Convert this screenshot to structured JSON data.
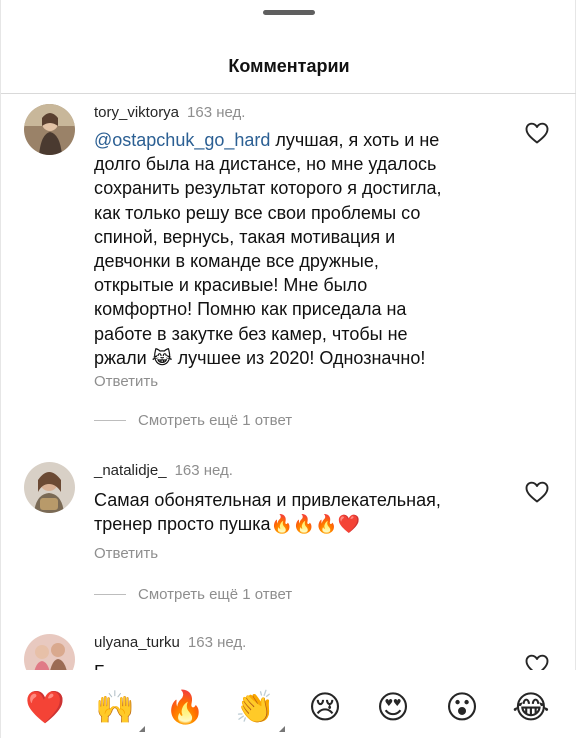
{
  "sheet": {
    "title": "Комментарии"
  },
  "comments": [
    {
      "username": "tory_viktorya",
      "time": "163 нед.",
      "mention": "@ostapchuk_go_hard",
      "lines": [
        " лучшая, я хоть и не",
        "долго была на дистансе, но мне удалось",
        "сохранить результат которого я достигла,",
        "как только решу все свои проблемы со",
        "спиной, вернусь, такая мотивация и",
        "девчонки в команде все дружные,",
        "открытые и красивые! Мне было",
        "комфортно! Помню как приседала на",
        "работе в закутке без камер, чтобы не",
        "ржали 😹 лучшее из 2020! Однозначно!"
      ],
      "reply_label": "Ответить",
      "more_replies": "Смотреть ещё 1 ответ"
    },
    {
      "username": "_natalidje_",
      "time": "163 нед.",
      "lines": [
        "Самая обонятельная и привлекательная,",
        "тренер просто пушка🔥🔥🔥❤️"
      ],
      "reply_label": "Ответить",
      "more_replies": "Смотреть ещё 1 ответ"
    },
    {
      "username": "ulyana_turku",
      "time": "163 нед.",
      "lines": [
        "Б"
      ]
    }
  ],
  "emoji_bar": [
    "❤️",
    "🙌",
    "🔥",
    "👏",
    "😢",
    "😍",
    "😮",
    "😂"
  ],
  "colors": {
    "mention": "#2b5f93",
    "secondary_text": "#8e8e8e"
  }
}
